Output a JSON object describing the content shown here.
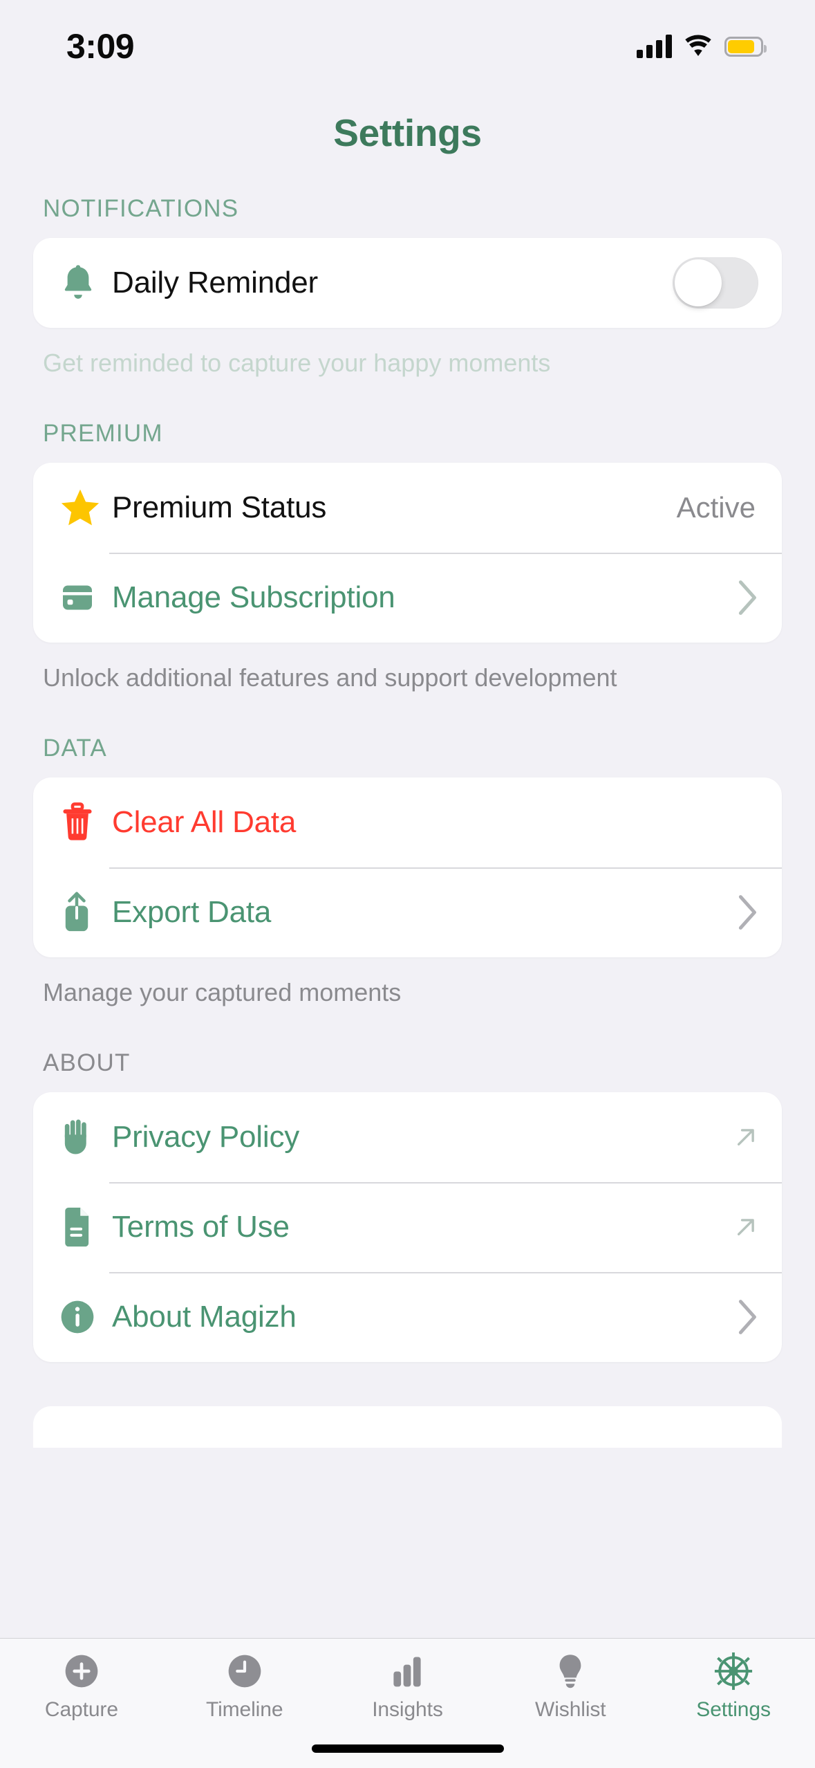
{
  "status_bar": {
    "time": "3:09",
    "signal_icon": "cellular-signal-icon",
    "wifi_icon": "wifi-icon",
    "battery_icon": "battery-low-power-icon"
  },
  "header": {
    "title": "Settings",
    "title_color": "#3d7a5c"
  },
  "colors": {
    "background": "#f2f1f6",
    "card": "#ffffff",
    "accent_green": "#4a9472",
    "header_green": "#74a68e",
    "destructive_red": "#ff3b30",
    "star_yellow": "#ffcc00",
    "grey_text": "#8a8a8e"
  },
  "sections": [
    {
      "header": "NOTIFICATIONS",
      "header_style": "green",
      "rows": [
        {
          "icon": "bell-icon",
          "label": "Daily Reminder",
          "label_style": "plain",
          "control": "toggle",
          "toggle_on": false
        }
      ],
      "footnote": "Get reminded to capture your happy moments",
      "footnote_style": "sage"
    },
    {
      "header": "PREMIUM",
      "header_style": "green",
      "rows": [
        {
          "icon": "star-icon",
          "label": "Premium Status",
          "label_style": "plain",
          "control": "value",
          "value": "Active"
        },
        {
          "icon": "credit-card-icon",
          "label": "Manage Subscription",
          "label_style": "green",
          "control": "chevron"
        }
      ],
      "footnote": "Unlock additional features and support development",
      "footnote_style": "grey"
    },
    {
      "header": "DATA",
      "header_style": "green",
      "rows": [
        {
          "icon": "trash-icon",
          "label": "Clear All Data",
          "label_style": "red",
          "control": "none"
        },
        {
          "icon": "export-share-icon",
          "label": "Export Data",
          "label_style": "green",
          "control": "chevron"
        }
      ],
      "footnote": "Manage your captured moments",
      "footnote_style": "grey"
    },
    {
      "header": "ABOUT",
      "header_style": "grey",
      "rows": [
        {
          "icon": "hand-raised-icon",
          "label": "Privacy Policy",
          "label_style": "green",
          "control": "external-link"
        },
        {
          "icon": "document-icon",
          "label": "Terms of Use",
          "label_style": "green",
          "control": "external-link"
        },
        {
          "icon": "info-circle-icon",
          "label": "About Magizh",
          "label_style": "green",
          "control": "chevron"
        }
      ],
      "footnote": "",
      "footnote_style": "grey"
    }
  ],
  "tab_bar": {
    "active_index": 4,
    "tabs": [
      {
        "label": "Capture",
        "icon": "plus-circle-icon"
      },
      {
        "label": "Timeline",
        "icon": "clock-icon"
      },
      {
        "label": "Insights",
        "icon": "bar-chart-icon"
      },
      {
        "label": "Wishlist",
        "icon": "lightbulb-icon"
      },
      {
        "label": "Settings",
        "icon": "gear-icon"
      }
    ]
  }
}
